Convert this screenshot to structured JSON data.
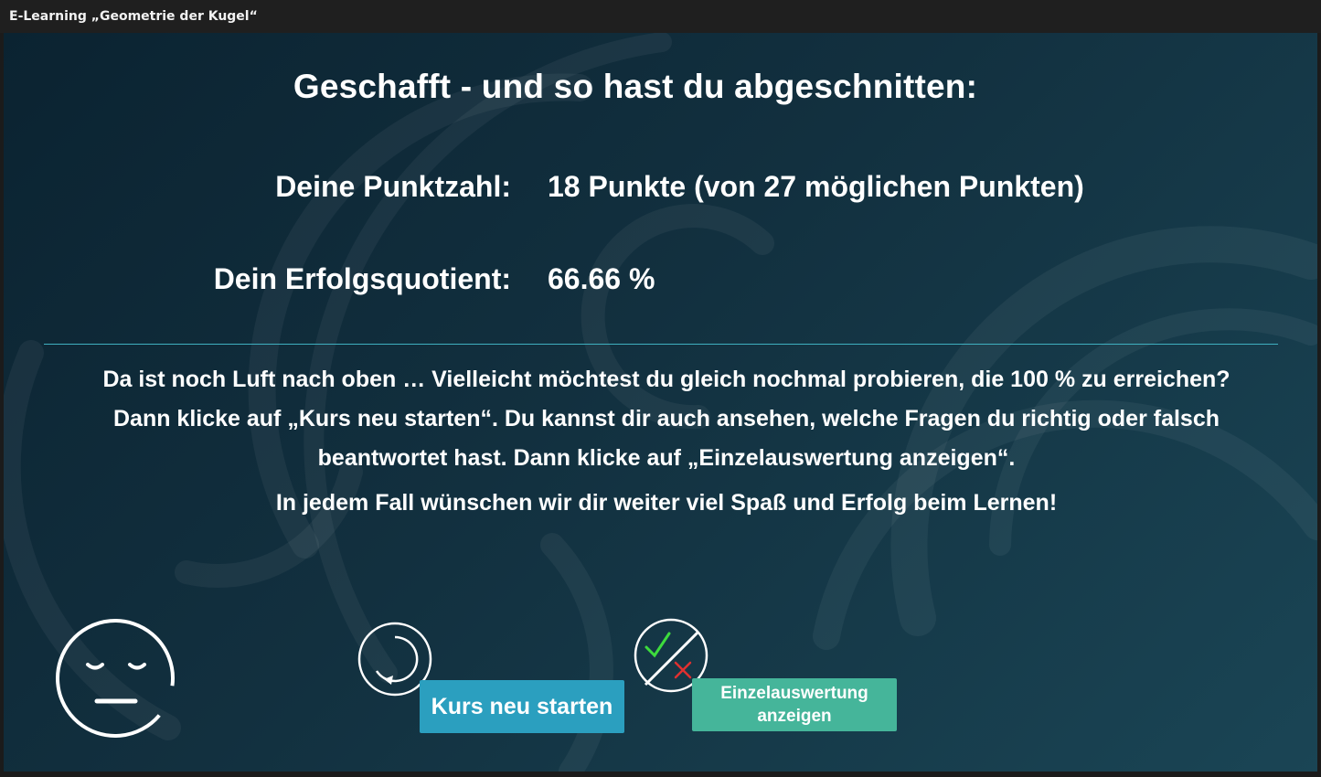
{
  "window": {
    "title": "E-Learning „Geometrie der Kugel“"
  },
  "result": {
    "heading": "Geschafft - und so hast du abgeschnitten:",
    "score_label": "Deine Punktzahl:",
    "score_value": "18 Punkte (von 27 möglichen Punkten)",
    "quotient_label": "Dein Erfolgsquotient:",
    "quotient_value": "66.66 %"
  },
  "message": {
    "text": "Da ist noch Luft nach oben … Vielleicht möchtest du gleich nochmal probieren, die 100 % zu erreichen? Dann klicke auf „Kurs neu starten“. Du kannst dir auch ansehen, welche Fragen du richtig oder falsch beantwortet hast. Dann klicke auf „Einzelauswertung anzeigen“.",
    "closing": "In jedem Fall wünschen wir dir weiter viel Spaß und Erfolg beim Lernen!"
  },
  "actions": {
    "restart_label": "Kurs neu starten",
    "evaluation_label_line1": "Einzelauswertung",
    "evaluation_label_line2": "anzeigen"
  },
  "icons": {
    "mood": "neutral-face-icon",
    "restart": "restart-icon",
    "evaluation": "check-cross-icon"
  },
  "colors": {
    "background_dark": "#0b2331",
    "background_light": "#1a4555",
    "divider": "#3fb0c0",
    "restart_button": "#2b9fbf",
    "evaluation_button": "#45b59a",
    "check": "#3ddc3d",
    "cross": "#e03030"
  }
}
